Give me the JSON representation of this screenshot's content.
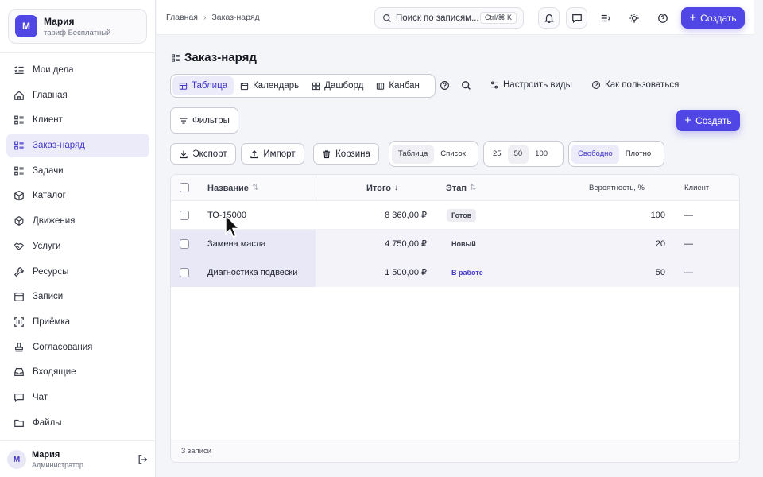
{
  "account": {
    "avatar_letter": "М",
    "name": "Мария",
    "plan": "тариф Бесплатный"
  },
  "sidebar": {
    "items": [
      {
        "label": "Мои дела",
        "icon": "list-check-icon"
      },
      {
        "label": "Главная",
        "icon": "home-icon"
      },
      {
        "label": "Клиент",
        "icon": "grid-list-icon"
      },
      {
        "label": "Заказ-наряд",
        "icon": "grid-list-icon",
        "active": true
      },
      {
        "label": "Задачи",
        "icon": "grid-list-icon"
      },
      {
        "label": "Каталог",
        "icon": "box-icon"
      },
      {
        "label": "Движения",
        "icon": "cube-icon"
      },
      {
        "label": "Услуги",
        "icon": "handshake-icon"
      },
      {
        "label": "Ресурсы",
        "icon": "wrench-icon"
      },
      {
        "label": "Записи",
        "icon": "calendar-icon"
      },
      {
        "label": "Приёмка",
        "icon": "scan-icon"
      },
      {
        "label": "Согласования",
        "icon": "stamp-icon"
      },
      {
        "label": "Входящие",
        "icon": "inbox-icon"
      },
      {
        "label": "Чат",
        "icon": "chat-icon"
      },
      {
        "label": "Файлы",
        "icon": "folder-icon"
      }
    ]
  },
  "user": {
    "avatar_letter": "М",
    "name": "Мария",
    "role": "Администратор"
  },
  "topbar": {
    "breadcrumb_home": "Главная",
    "breadcrumb_current": "Заказ-наряд",
    "search_placeholder": "Поиск по записям...",
    "search_shortcut": "Ctrl/⌘ K",
    "create_label": "Создать"
  },
  "page": {
    "title": "Заказ-наряд",
    "views": [
      "Таблица",
      "Календарь",
      "Дашборд",
      "Канбан"
    ],
    "active_view": "Таблица",
    "configure_views": "Настроить виды",
    "how_to_use": "Как пользоваться",
    "filters_label": "Фильтры",
    "create_label": "Создать",
    "export_label": "Экспорт",
    "import_label": "Импорт",
    "trash_label": "Корзина",
    "layout_options": [
      "Таблица",
      "Список"
    ],
    "page_size_options": [
      "25",
      "50",
      "100"
    ],
    "page_size_selected": "50",
    "density_options": [
      "Свободно",
      "Плотно"
    ]
  },
  "table": {
    "columns": [
      "Название",
      "Итого",
      "Этап",
      "Вероятность, %",
      "Клиент"
    ],
    "rows": [
      {
        "name": "ТО-15000",
        "total": "8 360,00 ₽",
        "stage": "Готов",
        "probability": "100",
        "client": "—"
      },
      {
        "name": "Замена масла",
        "total": "4 750,00 ₽",
        "stage": "Новый",
        "probability": "20",
        "client": "—"
      },
      {
        "name": "Диагностика подвески",
        "total": "1 500,00 ₽",
        "stage": "В работе",
        "probability": "50",
        "client": "—"
      }
    ],
    "footer": "3 записи"
  },
  "colors": {
    "accent": "#4f46e5",
    "active_bg": "#ecebfa"
  }
}
